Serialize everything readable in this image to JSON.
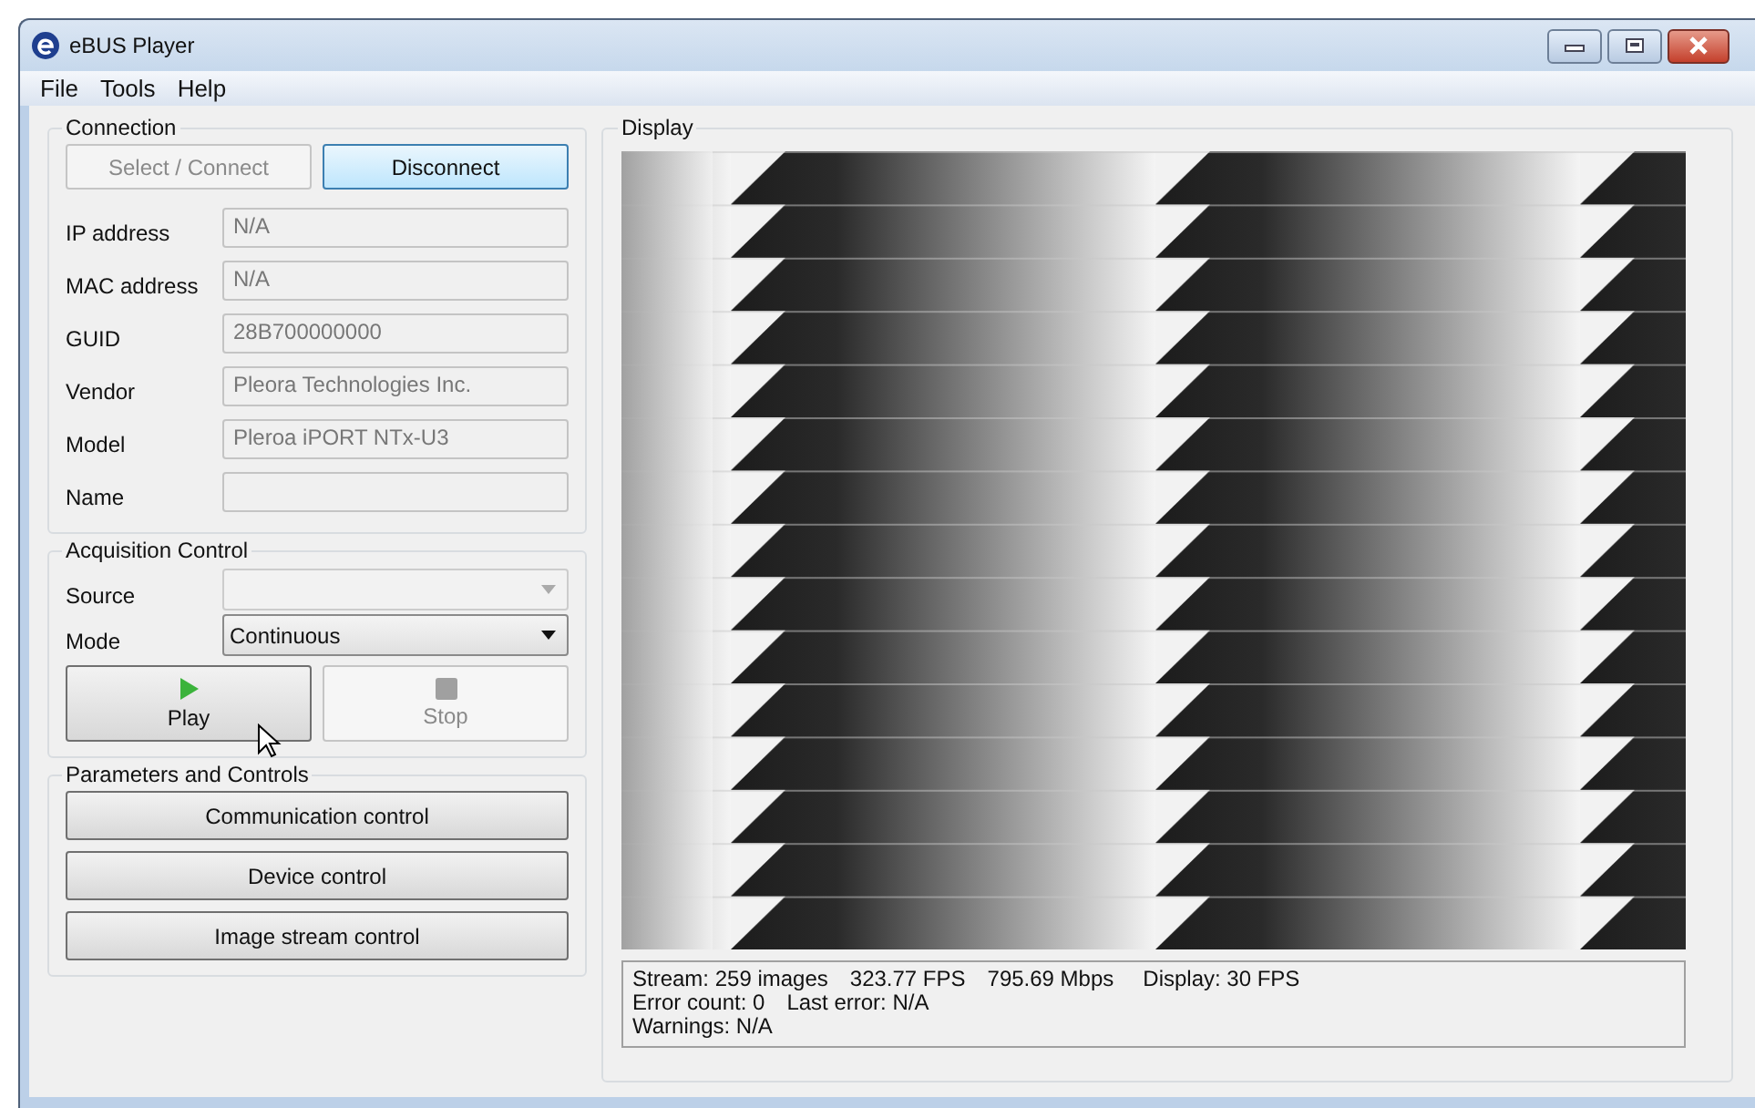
{
  "window": {
    "title": "eBUS Player"
  },
  "menu": [
    "File",
    "Tools",
    "Help"
  ],
  "connection": {
    "title": "Connection",
    "buttons": [
      {
        "label": "Select / Connect",
        "disabled": true
      },
      {
        "label": "Disconnect",
        "disabled": false
      }
    ],
    "fields": [
      {
        "label": "IP address",
        "value": "N/A"
      },
      {
        "label": "MAC address",
        "value": "N/A"
      },
      {
        "label": "GUID",
        "value": "28B700000000"
      },
      {
        "label": "Vendor",
        "value": "Pleora Technologies Inc."
      },
      {
        "label": "Model",
        "value": "Pleroa iPORT NTx-U3"
      },
      {
        "label": "Name"
      }
    ]
  },
  "acquisition": {
    "title": "Acquisition Control",
    "selects": [
      {
        "label": "Source",
        "disabled": true
      },
      {
        "label": "Mode",
        "value": "Continuous",
        "disabled": false
      }
    ],
    "buttons": [
      {
        "label": "Play",
        "kind": "play",
        "disabled": false
      },
      {
        "label": "Stop",
        "kind": "stop",
        "disabled": true
      }
    ]
  },
  "parameters": {
    "title": "Parameters and Controls",
    "buttons": [
      "Communication control",
      "Device control",
      "Image stream control"
    ]
  },
  "display": {
    "title": "Display",
    "image": {
      "kind": "picture"
    },
    "status_lines": [
      [
        "Stream: 259 images",
        "323.77 FPS",
        "795.69 Mbps",
        "Display: 30 FPS"
      ],
      [
        "Error count: 0",
        "Last error: N/A"
      ],
      [
        "Warnings: N/A"
      ]
    ]
  }
}
